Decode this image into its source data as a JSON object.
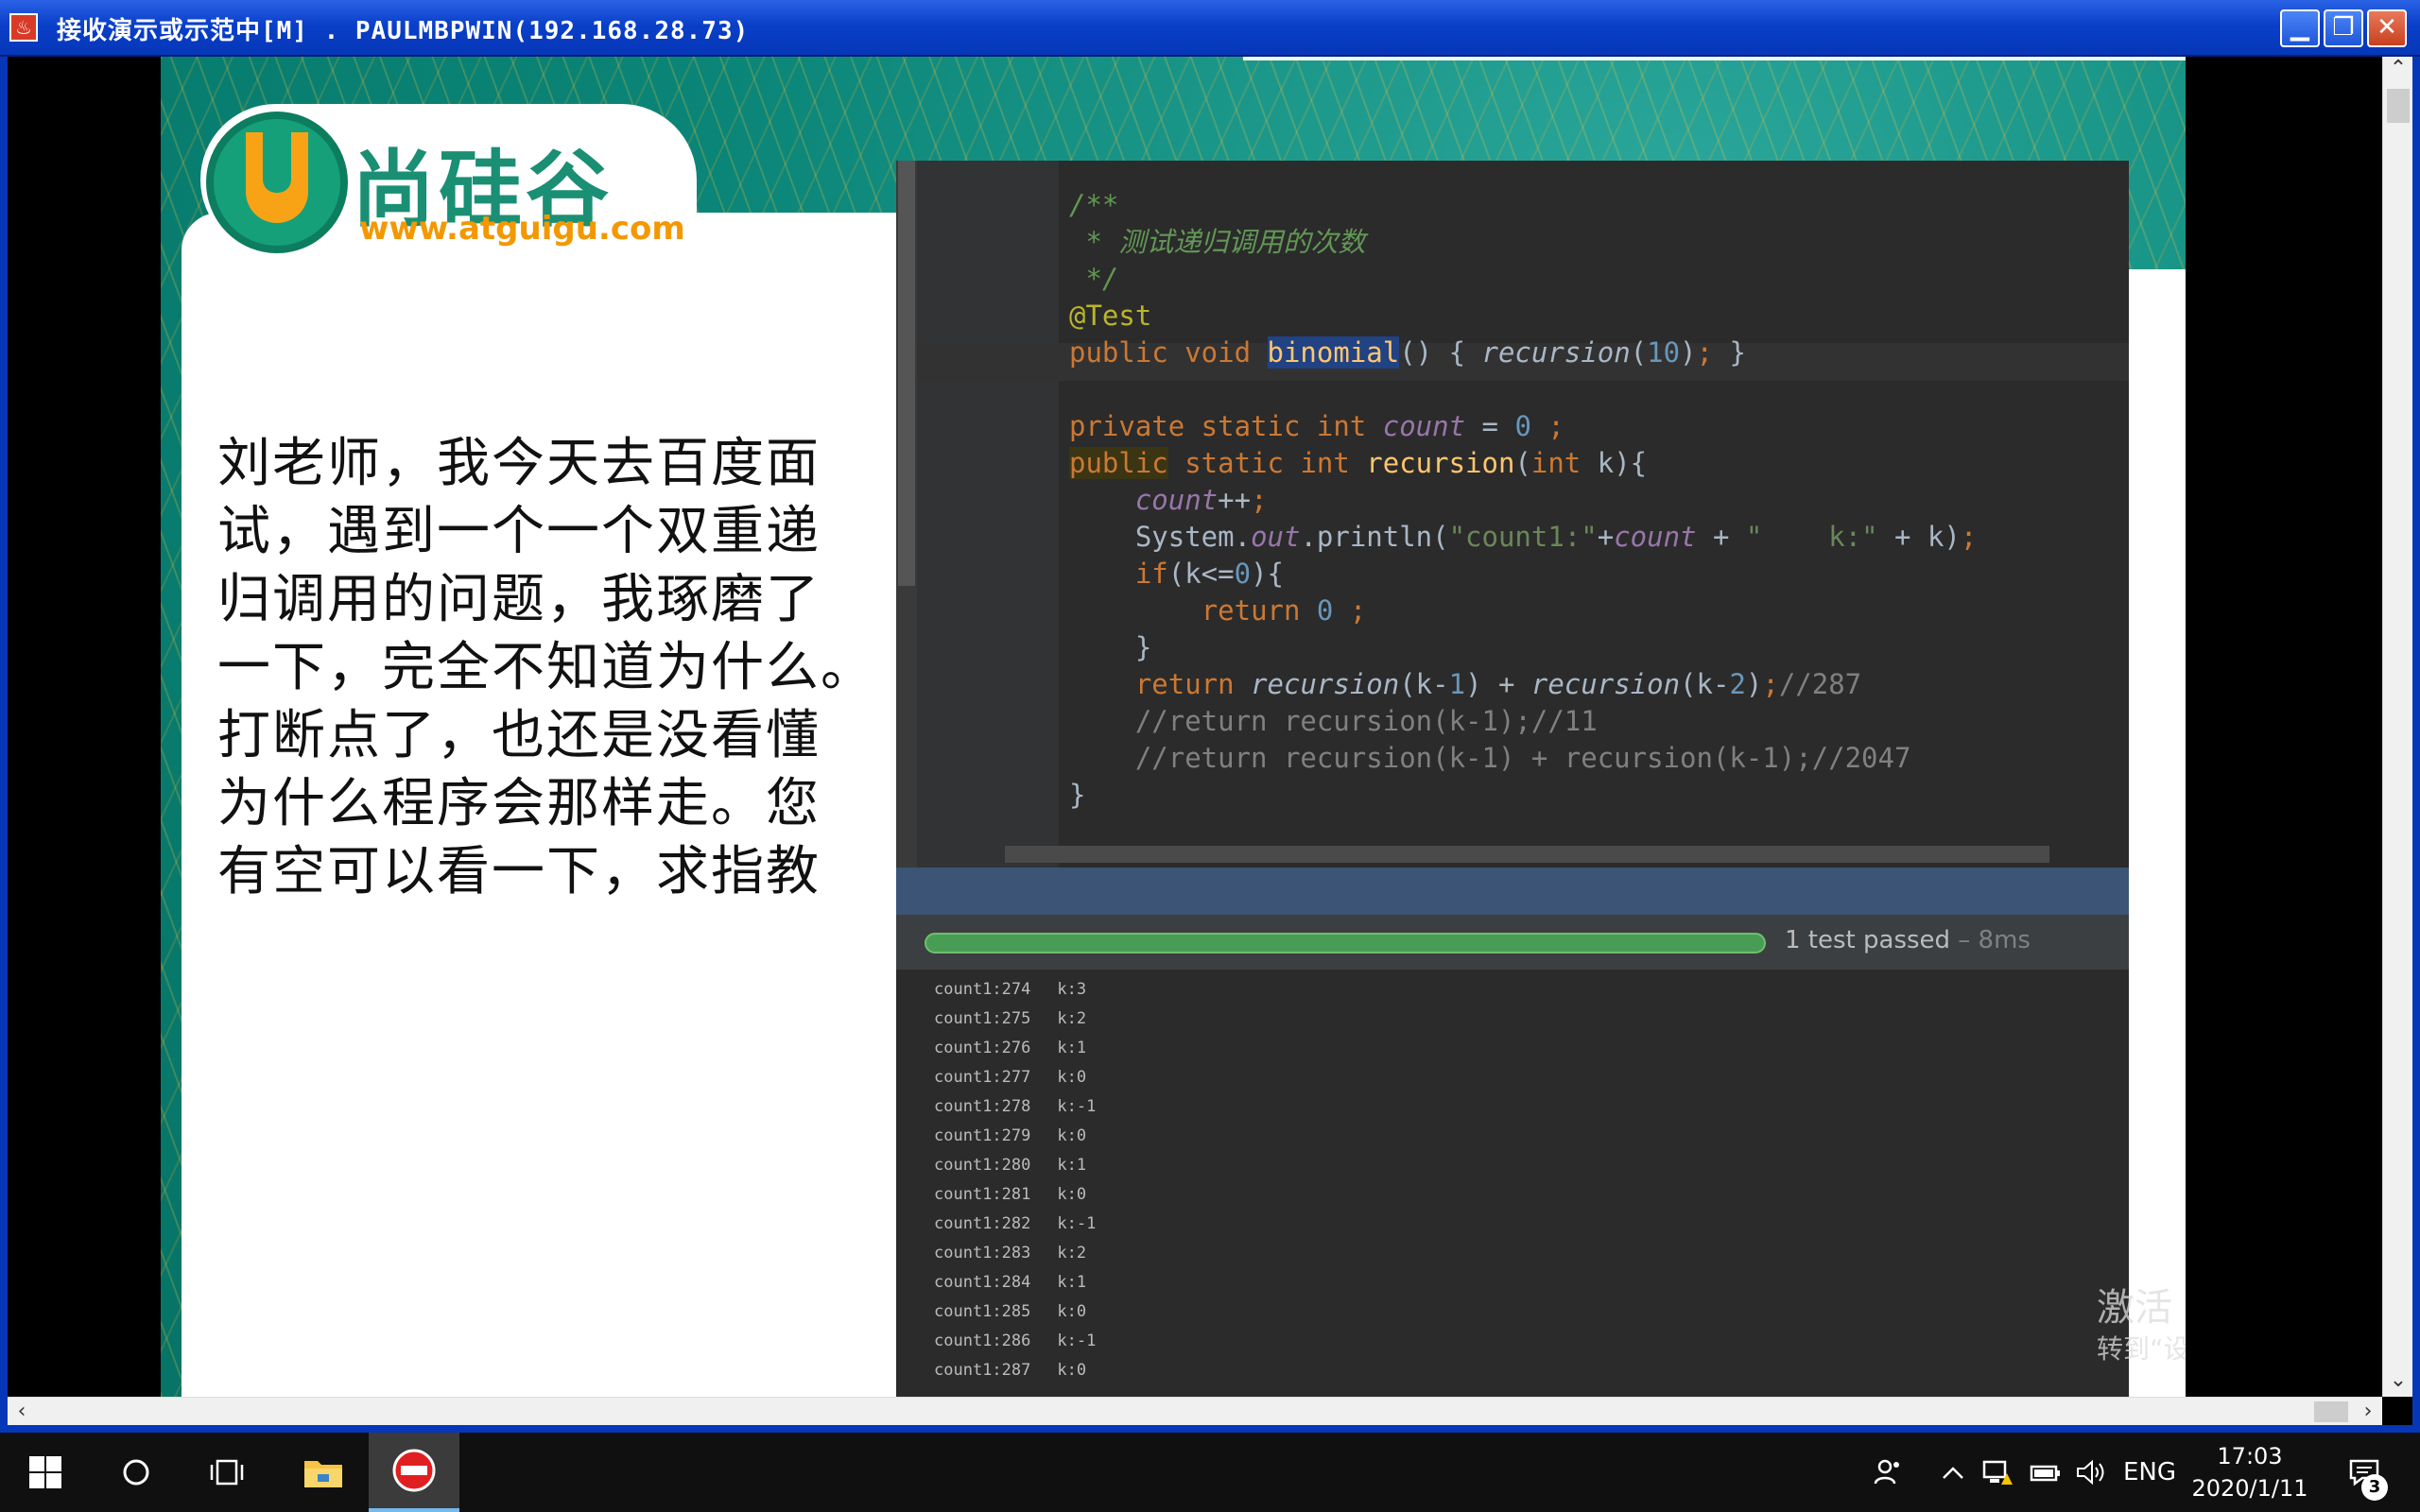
{
  "window": {
    "title": "接收演示或示范中[M] . PAULMBPWIN(192.168.28.73)",
    "minimize_label": "▁",
    "restore_label": "❐",
    "close_label": "✕"
  },
  "slide": {
    "logo_cn": "尚硅谷",
    "logo_url": "www.atguigu.com",
    "question": "刘老师，我今天去百度面\n试，遇到一个一个双重递\n归调用的问题，我琢磨了\n一下，完全不知道为什么。\n打断点了，也还是没看懂\n为什么程序会那样走。您\n有空可以看一下，求指教"
  },
  "ide": {
    "test_result": "1 test passed",
    "test_time": " – 8ms",
    "console_rows": [
      {
        "count": "count1:274",
        "k": "k:3"
      },
      {
        "count": "count1:275",
        "k": "k:2"
      },
      {
        "count": "count1:276",
        "k": "k:1"
      },
      {
        "count": "count1:277",
        "k": "k:0"
      },
      {
        "count": "count1:278",
        "k": "k:-1"
      },
      {
        "count": "count1:279",
        "k": "k:0"
      },
      {
        "count": "count1:280",
        "k": "k:1"
      },
      {
        "count": "count1:281",
        "k": "k:0"
      },
      {
        "count": "count1:282",
        "k": "k:-1"
      },
      {
        "count": "count1:283",
        "k": "k:2"
      },
      {
        "count": "count1:284",
        "k": "k:1"
      },
      {
        "count": "count1:285",
        "k": "k:0"
      },
      {
        "count": "count1:286",
        "k": "k:-1"
      },
      {
        "count": "count1:287",
        "k": "k:0"
      }
    ],
    "progress": 1.0
  },
  "watermark": {
    "line1": "激活 Windows",
    "line2": "转到“设置”以激活 Windows。"
  },
  "taskbar": {
    "lang": "ENG",
    "time": "17:03",
    "date": "2020/1/11",
    "notification_count": "3"
  },
  "icons": [
    "windows-start-icon",
    "search-circle-icon",
    "task-view-icon",
    "file-explorer-icon",
    "no-entry-icon",
    "people-icon",
    "chevron-up-icon",
    "network-icon",
    "battery-icon",
    "volume-icon",
    "notification-icon"
  ]
}
